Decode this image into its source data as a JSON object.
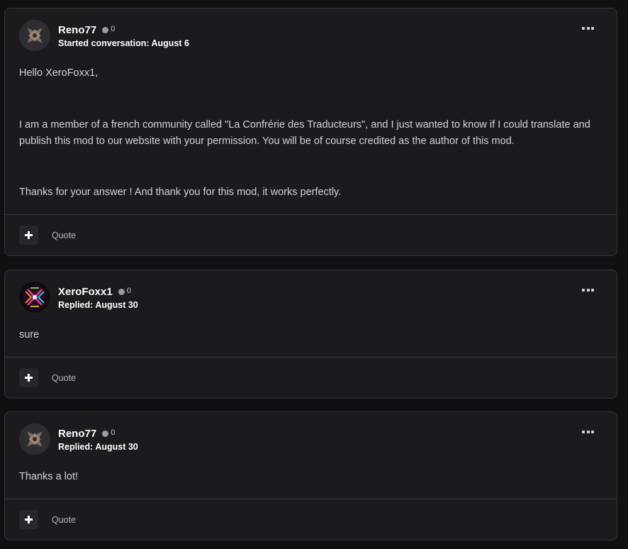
{
  "posts": [
    {
      "author": "Reno77",
      "reputation": "0",
      "meta": "Started conversation: August 6",
      "avatar_icon": "shuriken-logo-icon",
      "paragraphs": [
        "Hello XeroFoxx1,",
        "I am a member of a french community called \"La Confrérie des Traducteurs\", and I just wanted to know if I could translate and publish this mod to our website with your permission. You will be of course credited as the author of this mod.",
        "Thanks for your answer ! And thank you for this mod, it works perfectly."
      ],
      "quote_label": "Quote"
    },
    {
      "author": "XeroFoxx1",
      "reputation": "0",
      "meta": "Replied: August 30",
      "avatar_icon": "xero-logo-icon",
      "paragraphs": [
        "sure"
      ],
      "quote_label": "Quote"
    },
    {
      "author": "Reno77",
      "reputation": "0",
      "meta": "Replied: August 30",
      "avatar_icon": "shuriken-logo-icon",
      "paragraphs": [
        "Thanks a lot!"
      ],
      "quote_label": "Quote"
    }
  ],
  "icons": {
    "more": "more-options-icon",
    "plus": "plus-icon",
    "status": "online-status-dot-icon"
  },
  "colors": {
    "background": "#101012",
    "card": "#1b1b1f",
    "border": "#34343a",
    "text": "#d4d4d8",
    "author": "#ffffff",
    "shuriken": "#7a6a5e"
  }
}
